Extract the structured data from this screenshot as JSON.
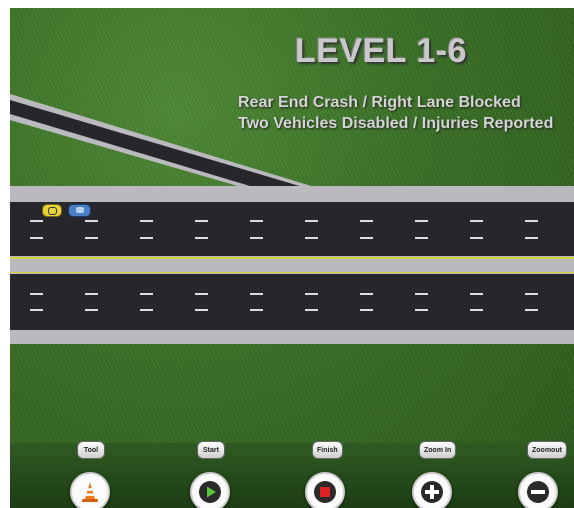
{
  "level": {
    "title": "LEVEL 1-6",
    "description_line1": "Rear End Crash / Right Lane Blocked",
    "description_line2": "Two Vehicles Disabled / Injuries Reported"
  },
  "scene": {
    "vehicles": [
      {
        "name": "yellow-car",
        "color": "#e8d23a"
      },
      {
        "name": "blue-car",
        "color": "#4a7fc8"
      }
    ],
    "colors": {
      "grass": "#3a7026",
      "asphalt": "#26262c",
      "shoulder": "#b9b9be",
      "median_line": "#d7d23c",
      "lane_dash": "#dddddd"
    }
  },
  "toolbar": {
    "buttons": [
      {
        "label": "Tool",
        "icon": "traffic-cone-icon"
      },
      {
        "label": "Start",
        "icon": "play-icon"
      },
      {
        "label": "Finish",
        "icon": "stop-icon"
      },
      {
        "label": "Zoom In",
        "icon": "zoom-in-icon"
      },
      {
        "label": "Zoomout",
        "icon": "zoom-out-icon"
      }
    ]
  }
}
